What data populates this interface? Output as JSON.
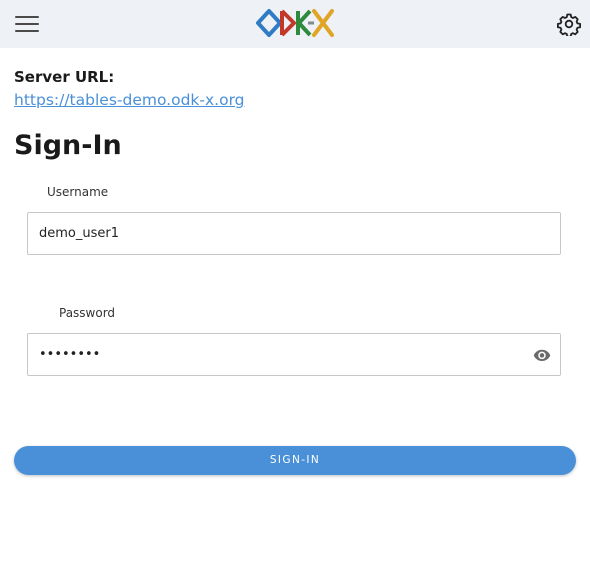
{
  "header": {
    "menu_icon": "hamburger-menu-icon",
    "logo_text": "ODK-X",
    "settings_icon": "gear-icon",
    "logo_colors": {
      "o": "#2f7cc4",
      "d": "#c0392b",
      "k": "#2e8b3e",
      "dash": "#7f8c8d",
      "x": "#e0a526"
    }
  },
  "server": {
    "label": "Server URL:",
    "url": "https://tables-demo.odk-x.org"
  },
  "signin": {
    "title": "Sign-In",
    "username_label": "Username",
    "username_value": "demo_user1",
    "password_label": "Password",
    "password_value": "••••••••",
    "password_visibility_icon": "eye-icon",
    "button_label": "SIGN-IN"
  },
  "colors": {
    "accent": "#4a90d9",
    "header_bg": "#eef1f6"
  }
}
